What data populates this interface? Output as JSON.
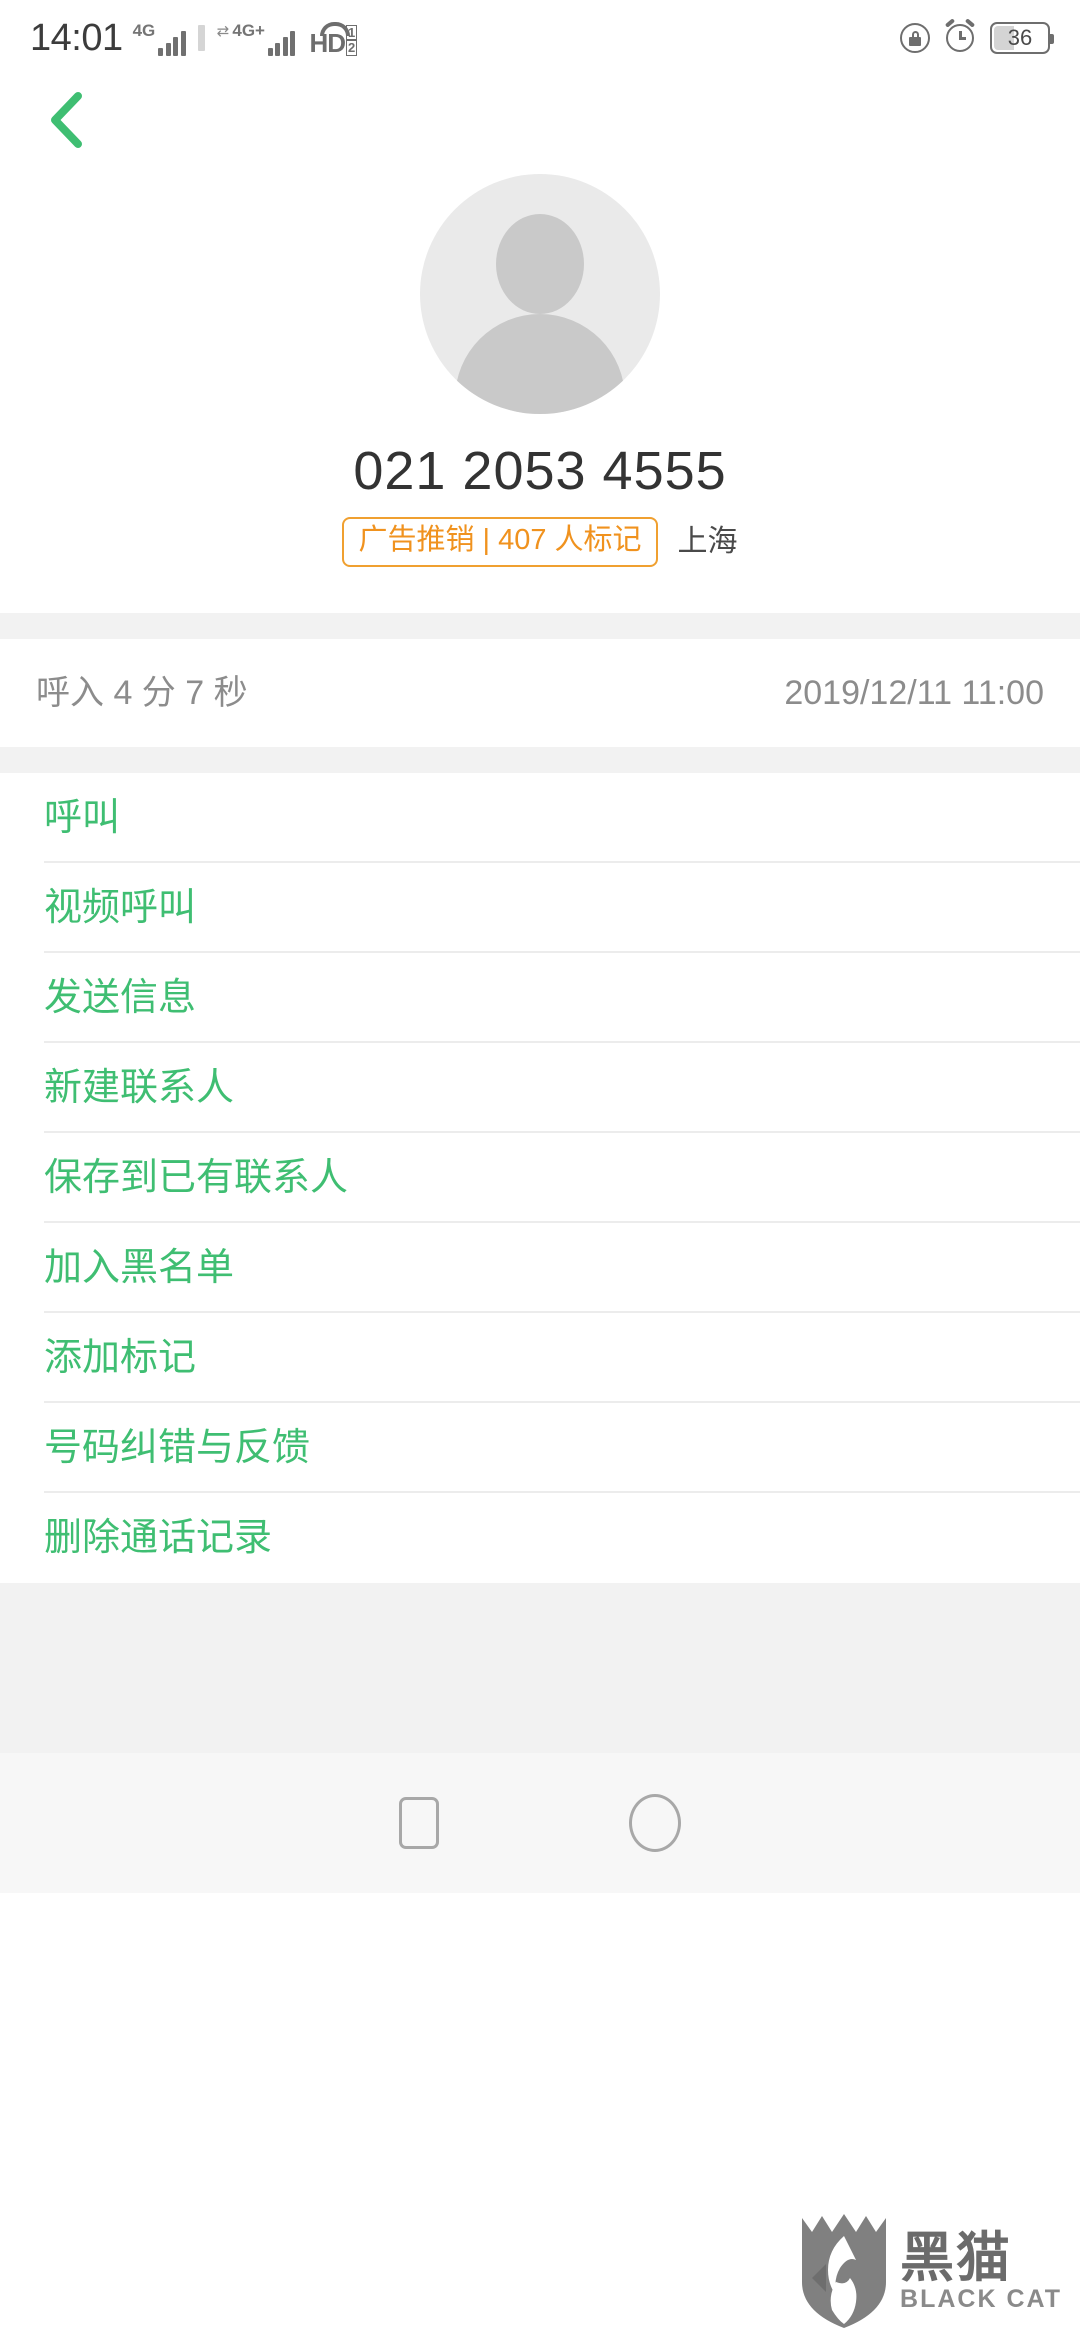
{
  "statusbar": {
    "time": "14:01",
    "sim1_network": "4G",
    "sim2_network": "4G+",
    "hd_label": "HD",
    "hd_sim_top": "1",
    "hd_sim_bottom": "2",
    "battery_percent": "36",
    "icons": {
      "rotation_lock": "rotation-lock-icon",
      "alarm": "alarm-icon",
      "battery": "battery-icon"
    }
  },
  "navbar": {
    "back_icon": "chevron-left-icon"
  },
  "profile": {
    "avatar_icon": "default-avatar-icon",
    "phone_number": "021 2053 4555",
    "spam_badge": "广告推销 | 407 人标记",
    "location": "上海"
  },
  "call_record": {
    "type_duration": "呼入 4 分 7 秒",
    "timestamp": "2019/12/11 11:00"
  },
  "actions": [
    {
      "label": "呼叫",
      "name": "call"
    },
    {
      "label": "视频呼叫",
      "name": "video-call"
    },
    {
      "label": "发送信息",
      "name": "send-message"
    },
    {
      "label": "新建联系人",
      "name": "new-contact"
    },
    {
      "label": "保存到已有联系人",
      "name": "save-to-existing-contact"
    },
    {
      "label": "加入黑名单",
      "name": "add-to-blacklist"
    },
    {
      "label": "添加标记",
      "name": "add-tag"
    },
    {
      "label": "号码纠错与反馈",
      "name": "number-correction-feedback"
    },
    {
      "label": "删除通话记录",
      "name": "delete-call-log"
    }
  ],
  "android_nav": {
    "recents_icon": "square-recents-icon",
    "home_icon": "circle-home-icon"
  },
  "watermark": {
    "cn": "黑猫",
    "en": "BLACK CAT",
    "logo_icon": "black-cat-shield-logo-icon"
  },
  "colors": {
    "accent_green": "#3fbe72",
    "spam_orange": "#f0921e",
    "muted_gray": "#8c8c8c",
    "band_gray": "#f2f2f2"
  }
}
